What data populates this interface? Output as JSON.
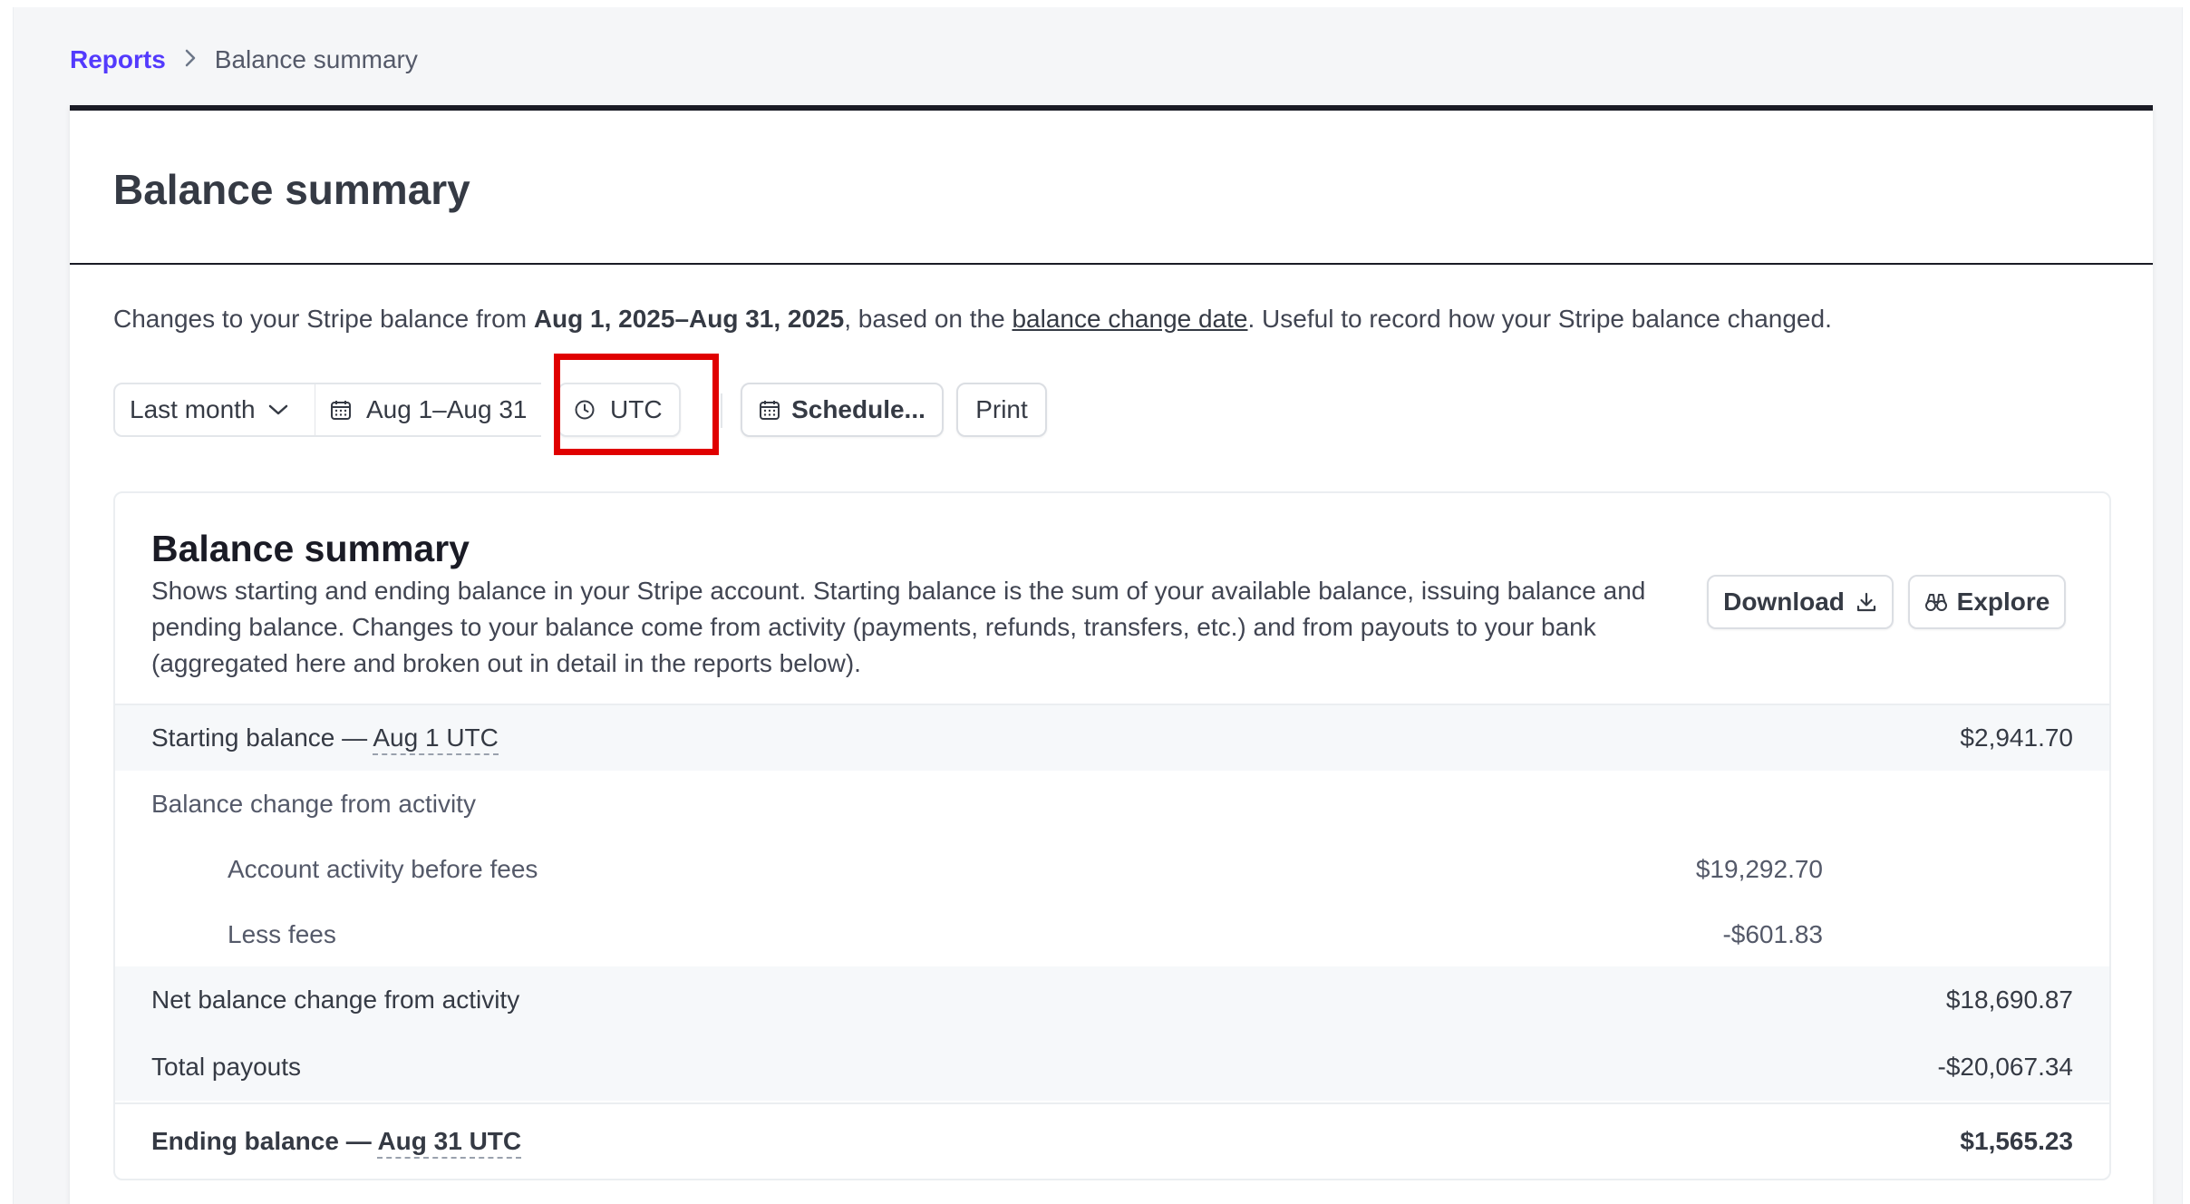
{
  "breadcrumb": {
    "parent": "Reports",
    "current": "Balance summary"
  },
  "page": {
    "title": "Balance summary",
    "description": {
      "prefix": "Changes to your Stripe balance from ",
      "date_range": "Aug 1, 2025–Aug 31, 2025",
      "middle": ", based on the ",
      "link": "balance change date",
      "suffix": ". Useful to record how your Stripe balance changed."
    }
  },
  "toolbar": {
    "range_label": "Last month",
    "date_label": "Aug 1–Aug 31",
    "timezone_label": "UTC",
    "schedule_label": "Schedule...",
    "print_label": "Print"
  },
  "summary": {
    "title": "Balance summary",
    "description": "Shows starting and ending balance in your Stripe account. Starting balance is the sum of your available balance, issuing balance and pending balance. Changes to your balance come from activity (payments, refunds, transfers, etc.) and from payouts to your bank (aggregated here and broken out in detail in the reports below).",
    "download_label": "Download",
    "explore_label": "Explore",
    "rows": {
      "starting": {
        "label": "Starting balance — ",
        "date": "Aug 1 UTC",
        "value": "$2,941.70"
      },
      "activity_header": {
        "label": "Balance change from activity"
      },
      "before_fees": {
        "label": "Account activity before fees",
        "value": "$19,292.70"
      },
      "less_fees": {
        "label": "Less fees",
        "value": "-$601.83"
      },
      "net_change": {
        "label": "Net balance change from activity",
        "value": "$18,690.87"
      },
      "payouts": {
        "label": "Total payouts",
        "value": "-$20,067.34"
      },
      "ending": {
        "label": "Ending balance — ",
        "date": "Aug 31 UTC",
        "value": "$1,565.23"
      }
    }
  },
  "colors": {
    "accent": "#533afd",
    "highlight": "#e00000",
    "rule": "#1a1b25"
  }
}
